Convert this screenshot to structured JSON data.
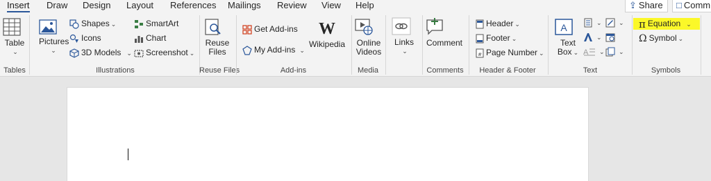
{
  "tabs": [
    {
      "label": "Insert",
      "active": true
    },
    {
      "label": "Draw"
    },
    {
      "label": "Design"
    },
    {
      "label": "Layout"
    },
    {
      "label": "References"
    },
    {
      "label": "Mailings"
    },
    {
      "label": "Review"
    },
    {
      "label": "View"
    },
    {
      "label": "Help"
    }
  ],
  "share": {
    "label": "Share"
  },
  "comments": {
    "label": "Comm"
  },
  "groups": {
    "tables": {
      "label": "Tables",
      "table_btn": "Table"
    },
    "illustrations": {
      "label": "Illustrations",
      "pictures": "Pictures",
      "shapes": "Shapes",
      "icons": "Icons",
      "models3d": "3D Models",
      "smartart": "SmartArt",
      "chart": "Chart",
      "screenshot": "Screenshot"
    },
    "reuse": {
      "label": "Reuse Files",
      "btn_line1": "Reuse",
      "btn_line2": "Files"
    },
    "addins": {
      "label": "Add-ins",
      "get": "Get Add-ins",
      "my": "My Add-ins",
      "wikipedia": "Wikipedia"
    },
    "media": {
      "label": "Media",
      "line1": "Online",
      "line2": "Videos"
    },
    "links": {
      "label": "Links"
    },
    "comments": {
      "label": "Comments",
      "btn": "Comment"
    },
    "headerfooter": {
      "label": "Header & Footer",
      "header": "Header",
      "footer": "Footer",
      "page_number": "Page Number"
    },
    "text": {
      "label": "Text",
      "textbox_line1": "Text",
      "textbox_line2": "Box"
    },
    "symbols": {
      "label": "Symbols",
      "equation": "Equation",
      "symbol": "Symbol",
      "pi": "π",
      "omega": "Ω"
    }
  },
  "colors": {
    "accent": "#2b579a",
    "highlight": "#fbf829"
  }
}
